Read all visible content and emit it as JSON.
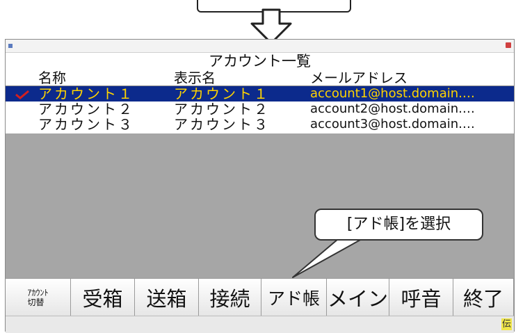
{
  "window": {
    "title": "",
    "list_title": "アカウント一覧"
  },
  "table": {
    "headers": [
      "名称",
      "表示名",
      "メールアドレス"
    ],
    "rows": [
      {
        "name": "アカウント１",
        "display": "アカウント１",
        "mail": "account1@host.domain.…",
        "checked": true
      },
      {
        "name": "アカウント２",
        "display": "アカウント２",
        "mail": "account2@host.domain.…",
        "checked": false
      },
      {
        "name": "アカウント３",
        "display": "アカウント３",
        "mail": "account3@host.domain.…",
        "checked": false
      }
    ]
  },
  "callout": {
    "text": "[アド帳]を選択"
  },
  "toolbar": {
    "buttons": [
      {
        "label": "ｱｶｳﾝﾄ\n切替"
      },
      {
        "label": "受箱"
      },
      {
        "label": "送箱"
      },
      {
        "label": "接続"
      },
      {
        "label": "アド帳"
      },
      {
        "label": "メイン"
      },
      {
        "label": "呼音"
      },
      {
        "label": "終了"
      }
    ]
  },
  "status": {
    "indicator": "伝"
  },
  "colors": {
    "selection_bg": "#0c2a8c",
    "selection_text": "#ffd400",
    "list_empty_area": "#a6a6a6",
    "checkmark": "#d21f1f"
  },
  "icons": {
    "top": "down-arrow-icon",
    "check": "checkmark-icon"
  }
}
